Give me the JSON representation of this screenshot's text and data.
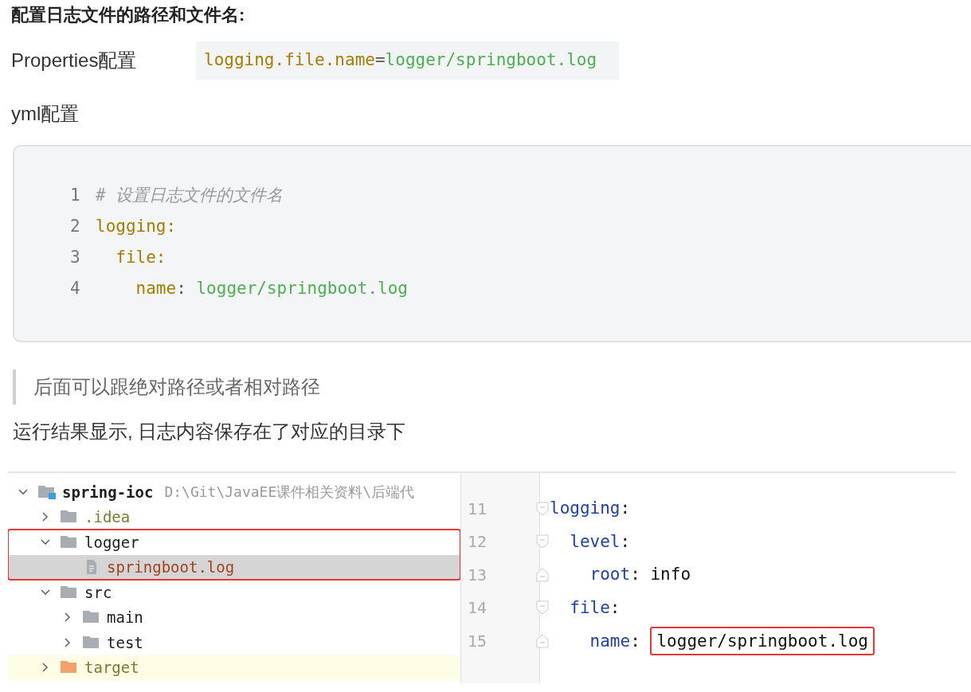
{
  "heading": "配置日志文件的路径和文件名:",
  "properties": {
    "label": "Properties配置",
    "code": [
      {
        "kind": "key",
        "text": "logging.file.name"
      },
      {
        "kind": "punct",
        "text": "="
      },
      {
        "kind": "value",
        "text": "logger/springboot.log"
      }
    ]
  },
  "yml_label": "yml配置",
  "code_block": {
    "lines": [
      {
        "number": "1",
        "tokens": [
          {
            "kind": "comment",
            "text": "# 设置日志文件的文件名"
          }
        ]
      },
      {
        "number": "2",
        "tokens": [
          {
            "kind": "key",
            "text": "logging:"
          }
        ]
      },
      {
        "number": "3",
        "tokens": [
          {
            "kind": "key",
            "text": "  file:"
          }
        ]
      },
      {
        "number": "4",
        "tokens": [
          {
            "kind": "key",
            "text": "    name"
          },
          {
            "kind": "punct",
            "text": ": "
          },
          {
            "kind": "value",
            "text": "logger/springboot.log"
          }
        ]
      }
    ]
  },
  "blockquote": "后面可以跟绝对路径或者相对路径",
  "paragraph": "运行结果显示, 日志内容保存在了对应的目录下",
  "ide": {
    "tree": [
      {
        "label": "spring-ioc",
        "path": "D:\\Git\\JavaEE课件相关资料\\后端代",
        "kind": "module",
        "expanded": true,
        "selected": false,
        "color": "#1e1e1e",
        "children": [
          {
            "label": ".idea",
            "kind": "folder",
            "expanded": false,
            "selected": false,
            "color": "#7b7b2e"
          },
          {
            "label": "logger",
            "kind": "folder",
            "expanded": true,
            "selected": false,
            "highlighted": true,
            "color": "#1e1e1e",
            "children": [
              {
                "label": "springboot.log",
                "kind": "file",
                "selected": true,
                "color": "#a2431f"
              }
            ]
          },
          {
            "label": "src",
            "kind": "folder",
            "expanded": true,
            "selected": false,
            "color": "#1e1e1e",
            "children": [
              {
                "label": "main",
                "kind": "folder",
                "expanded": false,
                "selected": false,
                "color": "#1e1e1e"
              },
              {
                "label": "test",
                "kind": "folder",
                "expanded": false,
                "selected": false,
                "color": "#1e1e1e"
              }
            ]
          },
          {
            "label": "target",
            "kind": "excluded",
            "expanded": false,
            "selected": false,
            "color": "#7b7b2e"
          }
        ]
      }
    ],
    "editor": [
      {
        "number": "11",
        "kind": "fold-start",
        "tokens": [
          {
            "kind": "key",
            "text": "logging"
          },
          {
            "kind": "punct",
            "text": ":"
          }
        ]
      },
      {
        "number": "12",
        "kind": "fold-start",
        "tokens": [
          {
            "kind": "key",
            "text": "  level"
          },
          {
            "kind": "punct",
            "text": ":"
          }
        ]
      },
      {
        "number": "13",
        "kind": "fold-end",
        "tokens": [
          {
            "kind": "key",
            "text": "    root"
          },
          {
            "kind": "punct",
            "text": ": "
          },
          {
            "kind": "value",
            "text": "info"
          }
        ]
      },
      {
        "number": "14",
        "kind": "fold-start",
        "tokens": [
          {
            "kind": "key",
            "text": "  file"
          },
          {
            "kind": "punct",
            "text": ":"
          }
        ]
      },
      {
        "number": "15",
        "kind": "fold-end",
        "tokens": [
          {
            "kind": "key",
            "text": "    name"
          },
          {
            "kind": "punct",
            "text": ": "
          },
          {
            "kind": "value",
            "text": "logger/springboot.log",
            "highlighted": true
          }
        ]
      }
    ]
  }
}
